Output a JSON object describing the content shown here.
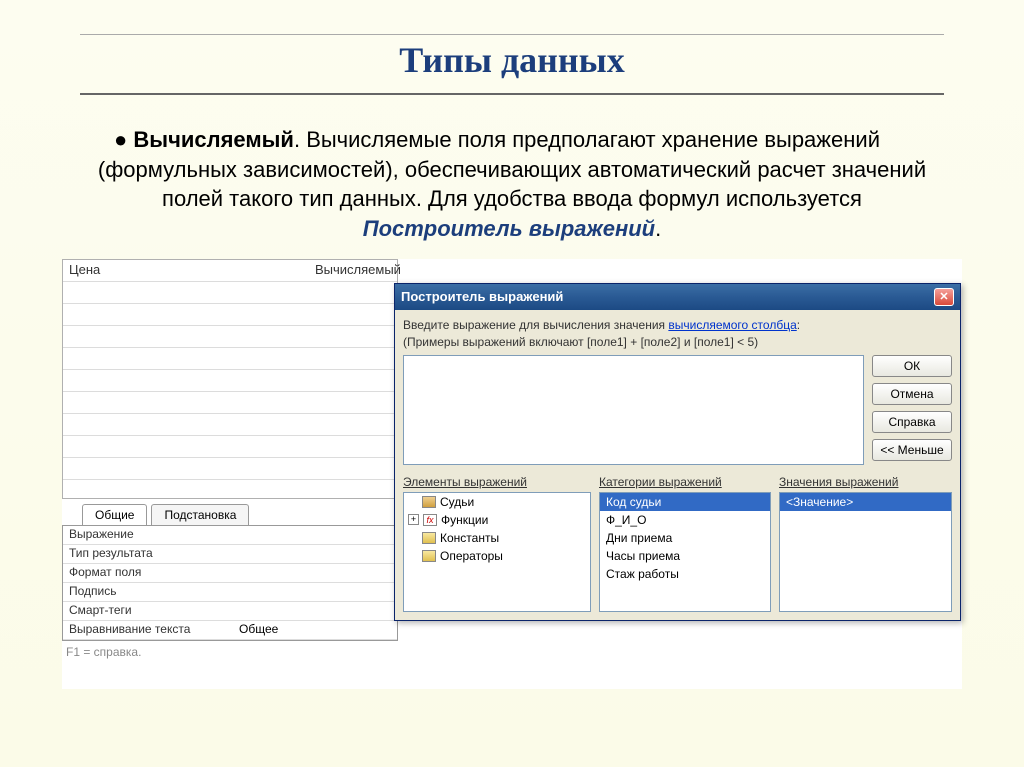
{
  "slide": {
    "title": "Типы данных",
    "bullet_strong": "Вычисляемый",
    "bullet_text1": ". Вычисляемые поля предполагают хранение выражений (формульных зависимостей), обеспечивающих автоматический расчет значений полей такого тип данных. Для удобства ввода формул используется ",
    "bullet_emph": "Построитель выражений",
    "bullet_text2": "."
  },
  "design": {
    "field_name": "Цена",
    "data_type": "Вычисляемый"
  },
  "prop_tabs": {
    "general": "Общие",
    "lookup": "Подстановка"
  },
  "props": {
    "p1": "Выражение",
    "p2": "Тип результата",
    "p3": "Формат поля",
    "p4": "Подпись",
    "p5": "Смарт-теги",
    "p6": "Выравнивание текста",
    "p6val": "Общее",
    "f1": "F1 = справка."
  },
  "dialog": {
    "title": "Построитель выражений",
    "prompt1": "Введите выражение для вычисления значения ",
    "prompt_link": "вычисляемого столбца",
    "prompt1_end": ":",
    "prompt2": "(Примеры выражений включают [поле1] + [поле2] и [поле1] < 5)",
    "btn_ok": "ОК",
    "btn_cancel": "Отмена",
    "btn_help": "Справка",
    "btn_less": "<< Меньше",
    "cat_label1": "Элементы выражений",
    "cat_label2": "Категории выражений",
    "cat_label3": "Значения выражений",
    "tree": {
      "t1": "Судьи",
      "t2": "Функции",
      "t3": "Константы",
      "t4": "Операторы"
    },
    "categories": {
      "c1": "Код судьи",
      "c2": "Ф_И_О",
      "c3": "Дни приема",
      "c4": "Часы приема",
      "c5": "Стаж работы"
    },
    "values": {
      "v1": "<Значение>"
    }
  }
}
